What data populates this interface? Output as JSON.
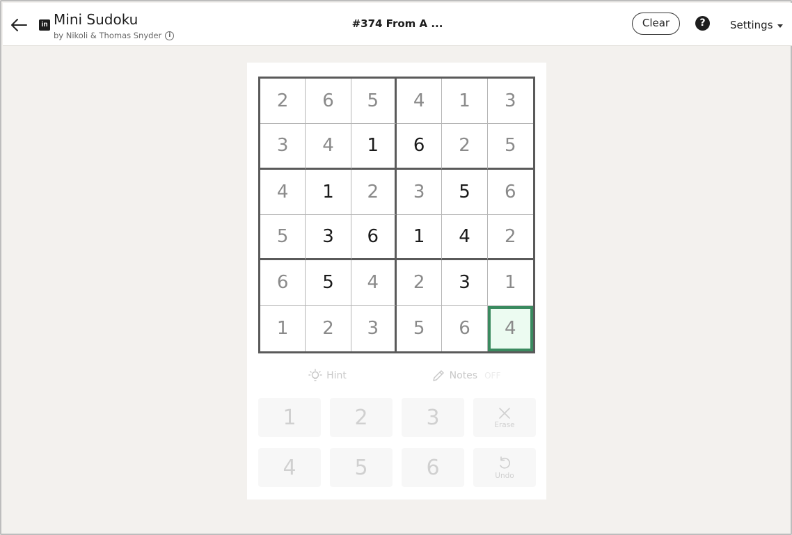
{
  "header": {
    "title": "Mini Sudoku",
    "byline": "by Nikoli & Thomas Snyder",
    "puzzle_title": "#374 From A ...",
    "clear_label": "Clear",
    "help_label": "?",
    "settings_label": "Settings",
    "logo_text": "in"
  },
  "board": {
    "rows": [
      [
        "2",
        "6",
        "5",
        "4",
        "1",
        "3"
      ],
      [
        "3",
        "4",
        "1",
        "6",
        "2",
        "5"
      ],
      [
        "4",
        "1",
        "2",
        "3",
        "5",
        "6"
      ],
      [
        "5",
        "3",
        "6",
        "1",
        "4",
        "2"
      ],
      [
        "6",
        "5",
        "4",
        "2",
        "3",
        "1"
      ],
      [
        "1",
        "2",
        "3",
        "5",
        "6",
        "4"
      ]
    ],
    "given": [
      [
        false,
        false,
        false,
        false,
        false,
        false
      ],
      [
        false,
        false,
        true,
        true,
        false,
        false
      ],
      [
        false,
        true,
        false,
        false,
        true,
        false
      ],
      [
        false,
        true,
        true,
        true,
        true,
        false
      ],
      [
        false,
        true,
        false,
        false,
        true,
        false
      ],
      [
        false,
        false,
        false,
        false,
        false,
        false
      ]
    ],
    "selected": [
      5,
      5
    ]
  },
  "tools": {
    "hint_label": "Hint",
    "notes_label": "Notes",
    "notes_state": "OFF"
  },
  "keypad": {
    "digits": [
      "1",
      "2",
      "3",
      "4",
      "5",
      "6"
    ],
    "erase_label": "Erase",
    "undo_label": "Undo"
  },
  "colors": {
    "selected_border": "#3a8a5f",
    "selected_fill": "#ecfbf1",
    "given_digit": "#1a1a1a",
    "entered_digit": "#8a8a8a"
  }
}
